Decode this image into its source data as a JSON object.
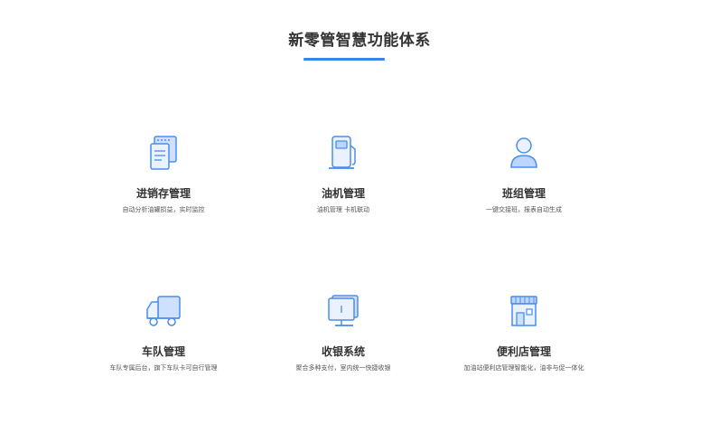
{
  "header": {
    "title": "新零管智慧功能体系"
  },
  "features": [
    {
      "name": "进销存管理",
      "desc": "自动分析油罐损益，实时监控",
      "icon": "inventory-document-icon"
    },
    {
      "name": "油机管理",
      "desc": "油机管理 卡机联动",
      "icon": "fuel-dispenser-icon"
    },
    {
      "name": "班组管理",
      "desc": "一键交接班，报表自动生成",
      "icon": "user-icon"
    },
    {
      "name": "车队管理",
      "desc": "车队专属后台，旗下车队卡可自行管理",
      "icon": "truck-icon"
    },
    {
      "name": "收银系统",
      "desc": "聚合多种支付，室内统一快捷收银",
      "icon": "monitor-icon"
    },
    {
      "name": "便利店管理",
      "desc": "加油站便利店管理智能化，油非与促一体化",
      "icon": "store-icon"
    }
  ],
  "colors": {
    "accent": "#3a86e6",
    "icon_light": "#bcd6ff",
    "icon_stroke": "#4a8df0"
  }
}
